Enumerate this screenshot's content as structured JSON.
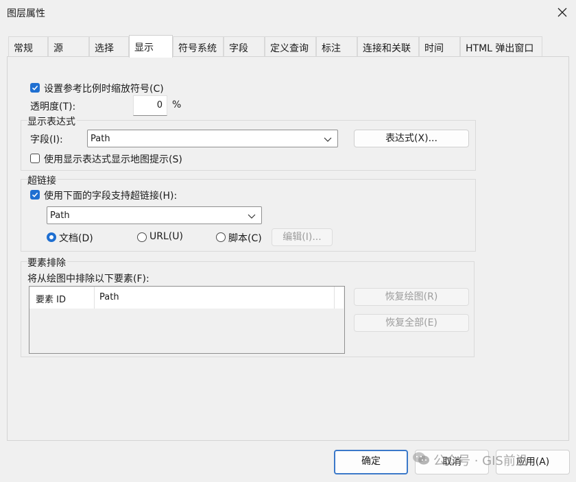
{
  "window": {
    "title": "图层属性",
    "close_icon": "close-icon"
  },
  "tabs": [
    {
      "label": "常规"
    },
    {
      "label": "源"
    },
    {
      "label": "选择"
    },
    {
      "label": "显示",
      "active": true
    },
    {
      "label": "符号系统"
    },
    {
      "label": "字段"
    },
    {
      "label": "定义查询"
    },
    {
      "label": "标注"
    },
    {
      "label": "连接和关联"
    },
    {
      "label": "时间"
    },
    {
      "label": "HTML 弹出窗口"
    }
  ],
  "display": {
    "scale_symbols_label": "设置参考比例时缩放符号(C)",
    "scale_symbols_checked": true,
    "transparency_label": "透明度(T):",
    "transparency_value": "0",
    "transparency_unit": "%"
  },
  "expression_group": {
    "title": "显示表达式",
    "field_label": "字段(I):",
    "field_value": "Path",
    "expression_button": "表达式(X)...",
    "maptips_label": "使用显示表达式显示地图提示(S)",
    "maptips_checked": false
  },
  "hyperlink_group": {
    "title": "超链接",
    "support_label": "使用下面的字段支持超链接(H):",
    "support_checked": true,
    "field_value": "Path",
    "radio_document": "文档(D)",
    "radio_url": "URL(U)",
    "radio_script": "脚本(C)",
    "selected": "document",
    "edit_button": "编辑(I)..."
  },
  "exclusion_group": {
    "title": "要素排除",
    "list_label": "将从绘图中排除以下要素(F):",
    "columns": [
      "要素 ID",
      "Path"
    ],
    "restore_drawing_button": "恢复绘图(R)",
    "restore_all_button": "恢复全部(E)"
  },
  "footer": {
    "ok": "确定",
    "cancel": "取消",
    "apply": "应用(A)"
  },
  "watermark": {
    "text": "公众号 · GIS前沿",
    "icon": "wechat-icon"
  },
  "colors": {
    "accent": "#1f6fd1",
    "background": "#f0f0f0"
  }
}
